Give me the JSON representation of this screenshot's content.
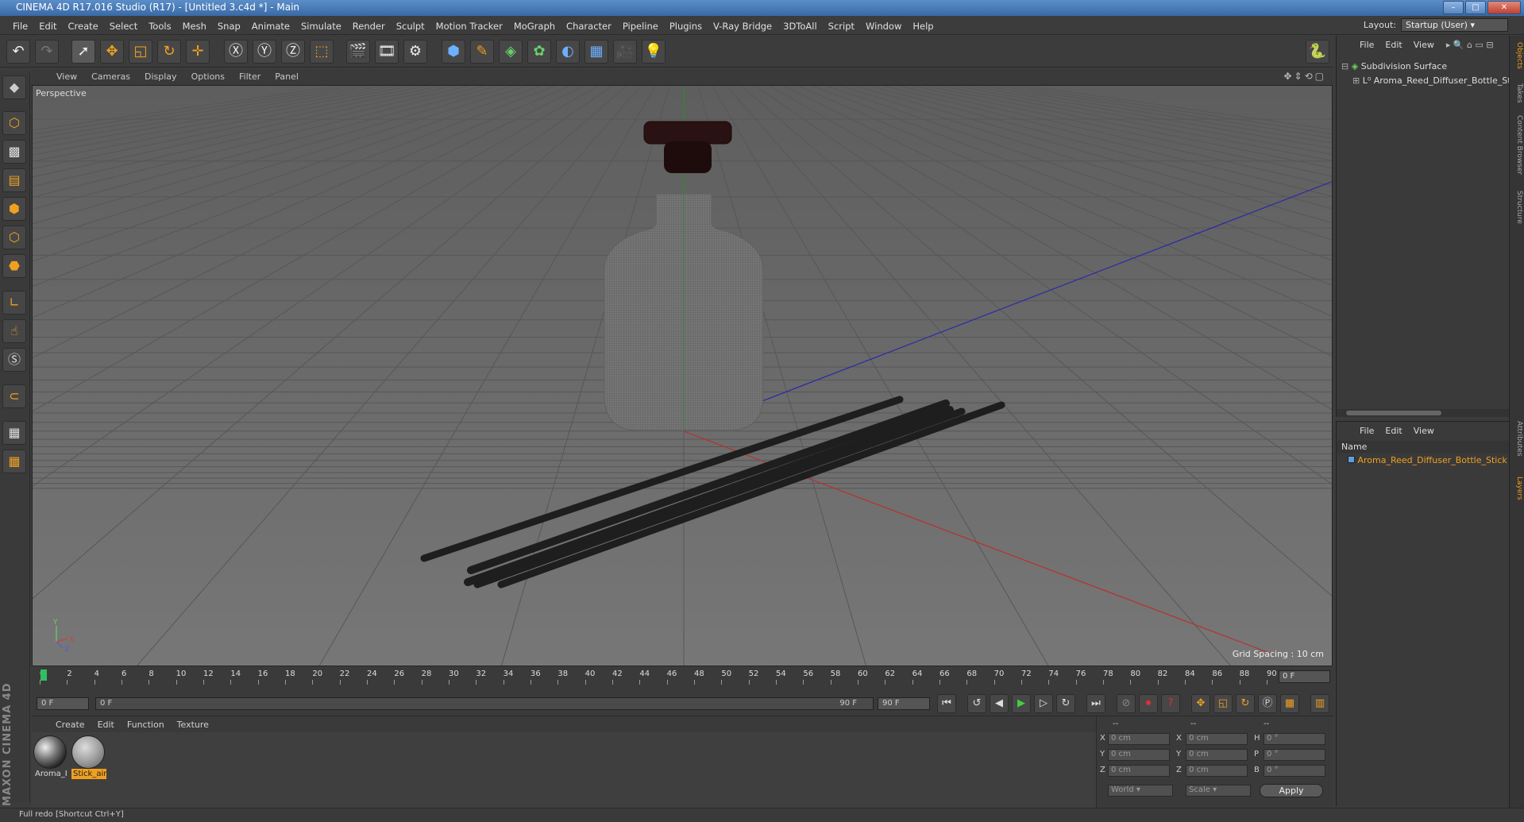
{
  "title": "CINEMA 4D R17.016 Studio (R17) - [Untitled 3.c4d *] - Main",
  "menu": [
    "File",
    "Edit",
    "Create",
    "Select",
    "Tools",
    "Mesh",
    "Snap",
    "Animate",
    "Simulate",
    "Render",
    "Sculpt",
    "Motion Tracker",
    "MoGraph",
    "Character",
    "Pipeline",
    "Plugins",
    "V-Ray Bridge",
    "3DToAll",
    "Script",
    "Window",
    "Help"
  ],
  "layout": {
    "label": "Layout:",
    "value": "Startup (User)"
  },
  "viewport": {
    "menu": [
      "View",
      "Cameras",
      "Display",
      "Options",
      "Filter",
      "Panel"
    ],
    "label": "Perspective",
    "grid_spacing": "Grid Spacing : 10 cm",
    "axis": {
      "y": "Y",
      "x": "X",
      "z": "Z"
    }
  },
  "timeline": {
    "ticks": [
      "0",
      "2",
      "4",
      "6",
      "8",
      "10",
      "12",
      "14",
      "16",
      "18",
      "20",
      "22",
      "24",
      "26",
      "28",
      "30",
      "32",
      "34",
      "36",
      "38",
      "40",
      "42",
      "44",
      "46",
      "48",
      "50",
      "52",
      "54",
      "56",
      "58",
      "60",
      "62",
      "64",
      "66",
      "68",
      "70",
      "72",
      "74",
      "76",
      "78",
      "80",
      "82",
      "84",
      "86",
      "88",
      "90"
    ],
    "current_frame": "0 F",
    "start": "0 F",
    "range_start": "0 F",
    "range_end": "90 F",
    "end": "90 F"
  },
  "materials": {
    "menu": [
      "Create",
      "Edit",
      "Function",
      "Texture"
    ],
    "items": [
      {
        "label": "Aroma_I"
      },
      {
        "label": "Stick_air"
      }
    ]
  },
  "brand": "MAXON CINEMA 4D",
  "coords": {
    "header": [
      "--",
      "--",
      "--"
    ],
    "rows": [
      {
        "a": "X",
        "av": "0 cm",
        "b": "X",
        "bv": "0 cm",
        "c": "H",
        "cv": "0 °"
      },
      {
        "a": "Y",
        "av": "0 cm",
        "b": "Y",
        "bv": "0 cm",
        "c": "P",
        "cv": "0 °"
      },
      {
        "a": "Z",
        "av": "0 cm",
        "b": "Z",
        "bv": "0 cm",
        "c": "B",
        "cv": "0 °"
      }
    ],
    "mode1": "World",
    "mode2": "Scale",
    "apply": "Apply"
  },
  "objects": {
    "menu": [
      "File",
      "Edit",
      "View"
    ],
    "items": [
      "Subdivision Surface",
      "Aroma_Reed_Diffuser_Bottle_Stic"
    ]
  },
  "layers": {
    "menu": [
      "File",
      "Edit",
      "View"
    ],
    "column": "Name",
    "items": [
      "Aroma_Reed_Diffuser_Bottle_Stick"
    ]
  },
  "side_tabs": [
    "Objects",
    "Takes",
    "Content Browser",
    "Structure",
    "Attributes",
    "Layers"
  ],
  "status": "Full redo [Shortcut Ctrl+Y]",
  "colors": {
    "accent": "#f0a020",
    "selection": "#e89a20",
    "grid_x": "#c83232",
    "grid_z": "#3232c8",
    "grid_y": "#32a032"
  }
}
